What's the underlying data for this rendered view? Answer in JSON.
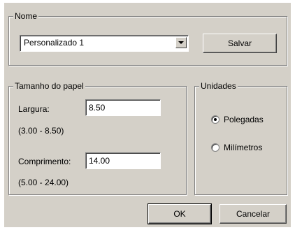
{
  "nome": {
    "legend": "Nome",
    "selected_value": "Personalizado 1",
    "save_label": "Salvar"
  },
  "tamanho": {
    "legend": "Tamanho do papel",
    "largura_label": "Largura:",
    "largura_value": "8.50",
    "largura_range": "(3.00 - 8.50)",
    "comprimento_label": "Comprimento:",
    "comprimento_value": "14.00",
    "comprimento_range": "(5.00 - 24.00)"
  },
  "unidades": {
    "legend": "Unidades",
    "options": [
      {
        "label": "Polegadas",
        "selected": true
      },
      {
        "label": "Milímetros",
        "selected": false
      }
    ]
  },
  "buttons": {
    "ok_label": "OK",
    "cancel_label": "Cancelar"
  },
  "icons": {
    "dropdown": "chevron-down-icon"
  }
}
